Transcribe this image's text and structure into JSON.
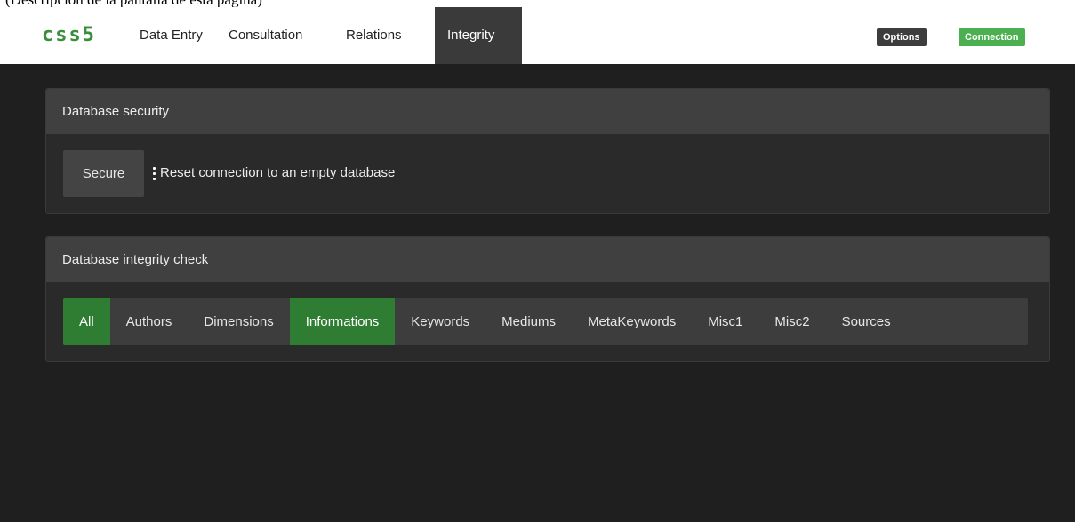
{
  "page_note": "(Descripción de la pantalla de esta página)",
  "navbar": {
    "brand": "css5",
    "items": [
      {
        "label": "Data Entry",
        "active": false
      },
      {
        "label": "Consultation",
        "active": false
      },
      {
        "label": "Relations",
        "active": false
      },
      {
        "label": "Integrity",
        "active": true
      }
    ],
    "options_label": "Options",
    "connection_label": "Connection",
    "brand_color": "#3a8f3a",
    "options_color": "#3d3d3d",
    "connection_color": "#4caf50"
  },
  "security_panel": {
    "title": "Database security",
    "secure_button": "Secure",
    "description": "Reset connection to an empty database"
  },
  "integrity_panel": {
    "title": "Database integrity check",
    "tabs": [
      {
        "label": "All",
        "highlight": true
      },
      {
        "label": "Authors",
        "highlight": false
      },
      {
        "label": "Dimensions",
        "highlight": false
      },
      {
        "label": "Informations",
        "highlight": true
      },
      {
        "label": "Keywords",
        "highlight": false
      },
      {
        "label": "Mediums",
        "highlight": false
      },
      {
        "label": "MetaKeywords",
        "highlight": false
      },
      {
        "label": "Misc1",
        "highlight": false
      },
      {
        "label": "Misc2",
        "highlight": false
      },
      {
        "label": "Sources",
        "highlight": false
      }
    ],
    "highlight_color": "#2f7d32"
  }
}
